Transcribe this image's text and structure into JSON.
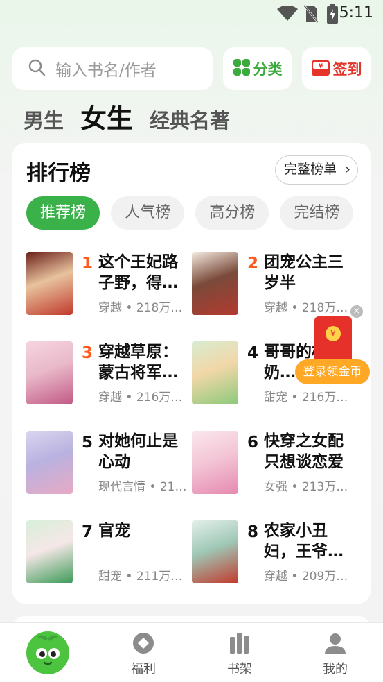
{
  "status_bar": {
    "time": "5:11"
  },
  "search": {
    "placeholder": "输入书名/作者"
  },
  "header_buttons": {
    "category": "分类",
    "signin": "签到"
  },
  "gender_tabs": [
    {
      "label": "男生",
      "active": false
    },
    {
      "label": "女生",
      "active": true
    },
    {
      "label": "经典名著",
      "active": false
    }
  ],
  "ranking": {
    "title": "排行榜",
    "full_list": "完整榜单",
    "tabs": [
      {
        "label": "推荐榜",
        "active": true
      },
      {
        "label": "人气榜",
        "active": false
      },
      {
        "label": "高分榜",
        "active": false
      },
      {
        "label": "完结榜",
        "active": false
      }
    ],
    "books": [
      {
        "rank": "1",
        "title": "这个王妃路子野，得…",
        "meta": "穿越 • 218万…",
        "cover_colors": [
          "#6b1f1a",
          "#c0392b",
          "#e8c39e"
        ]
      },
      {
        "rank": "2",
        "title": "团宠公主三岁半",
        "meta": "穿越 • 218万…",
        "cover_colors": [
          "#f4eae0",
          "#b33a2f",
          "#7a4a3a"
        ]
      },
      {
        "rank": "3",
        "title": "穿越草原：蒙古将军…",
        "meta": "穿越 • 216万…",
        "cover_colors": [
          "#f6d5e0",
          "#c25a86",
          "#e9b9c9"
        ]
      },
      {
        "rank": "4",
        "title": "哥哥的梅奶…",
        "meta": "甜宠 • 216万…",
        "cover_colors": [
          "#d7ecd0",
          "#8cc97a",
          "#f2d7a8"
        ]
      },
      {
        "rank": "5",
        "title": "对她何止是心动",
        "meta": "现代言情 • 21…",
        "cover_colors": [
          "#d9d6ef",
          "#e8a9c5",
          "#b9b2e0"
        ]
      },
      {
        "rank": "6",
        "title": "快穿之女配只想谈恋爱",
        "meta": "女强 • 213万…",
        "cover_colors": [
          "#fbe7ee",
          "#e58ab0",
          "#f3c6d6"
        ]
      },
      {
        "rank": "7",
        "title": "官宠",
        "meta": "甜宠 • 211万…",
        "cover_colors": [
          "#d8efd9",
          "#3c9a57",
          "#f5e7e7"
        ]
      },
      {
        "rank": "8",
        "title": "农家小丑妇，王爷…",
        "meta": "穿越 • 209万…",
        "cover_colors": [
          "#e4f0ea",
          "#c1392b",
          "#9fc7b6"
        ]
      }
    ]
  },
  "float_promo": {
    "label": "登录领金币",
    "coin": "¥"
  },
  "bottom_nav": [
    {
      "label": ""
    },
    {
      "label": "福利"
    },
    {
      "label": "书架"
    },
    {
      "label": "我的"
    }
  ]
}
